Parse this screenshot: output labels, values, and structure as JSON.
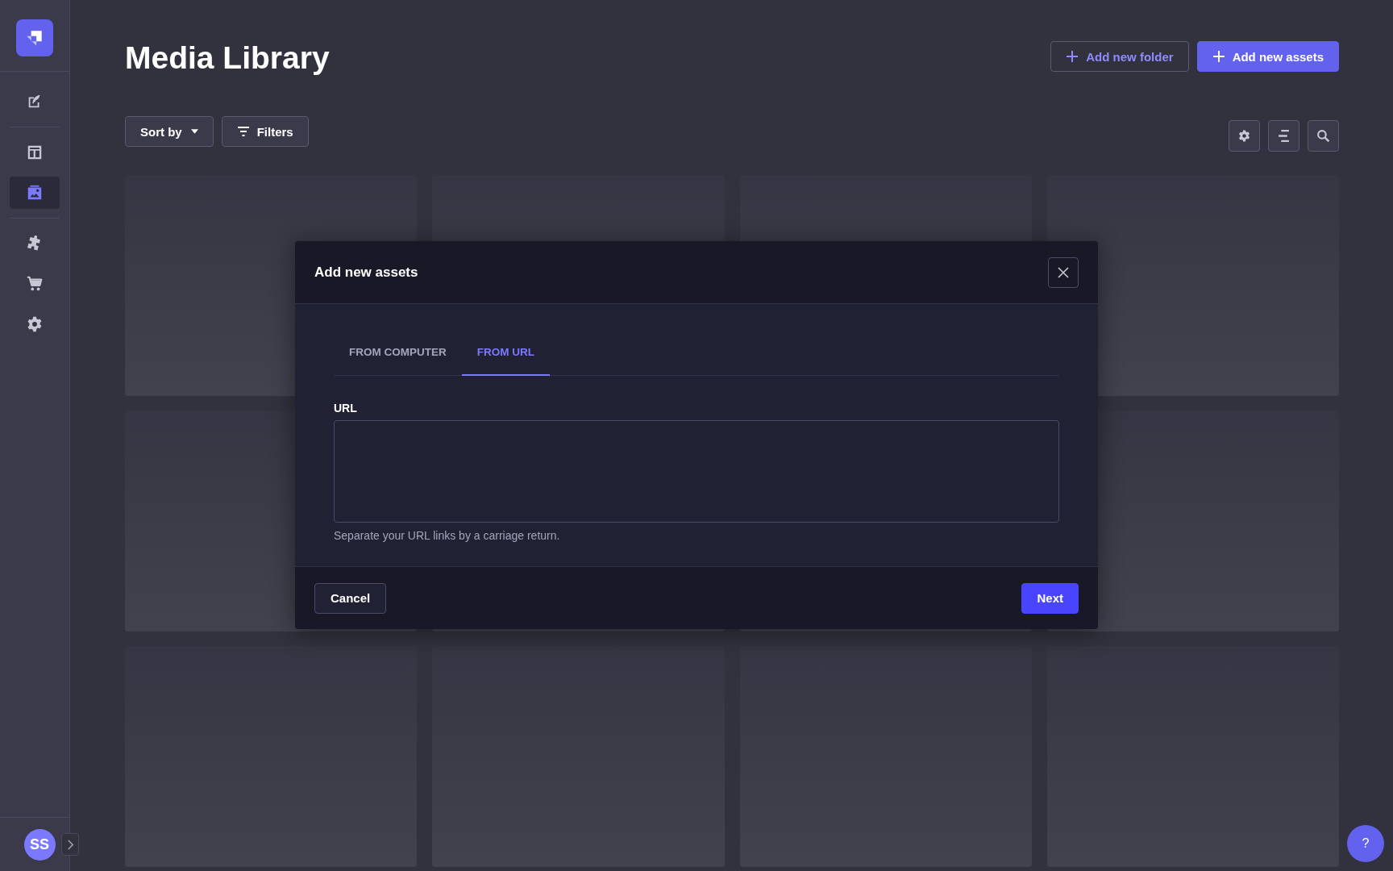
{
  "sidebar": {
    "nav_items": [
      {
        "kind": "content",
        "selected": false
      },
      {
        "kind": "builder",
        "selected": false
      },
      {
        "kind": "media",
        "selected": true
      },
      {
        "kind": "plugins",
        "selected": false
      },
      {
        "kind": "marketplace",
        "selected": false
      },
      {
        "kind": "settings",
        "selected": false
      }
    ],
    "avatar": "SS"
  },
  "page": {
    "title": "Media Library",
    "actions": [
      {
        "label": "Add new folder",
        "kind": "secondary"
      },
      {
        "label": "Add new assets",
        "kind": "primary"
      }
    ],
    "toolbar": {
      "sort": "Sort by",
      "filters": "Filters"
    }
  },
  "dialog": {
    "title": "Add new assets",
    "tabs": [
      {
        "label": "FROM COMPUTER",
        "selected": false
      },
      {
        "label": "FROM URL",
        "selected": true
      }
    ],
    "url_field": {
      "label": "URL",
      "hint": "Separate your URL links by a carriage return."
    },
    "buttons": [
      {
        "label": "Cancel",
        "kind": "secondary"
      },
      {
        "label": "Next",
        "kind": "primary"
      }
    ]
  },
  "help": "?"
}
